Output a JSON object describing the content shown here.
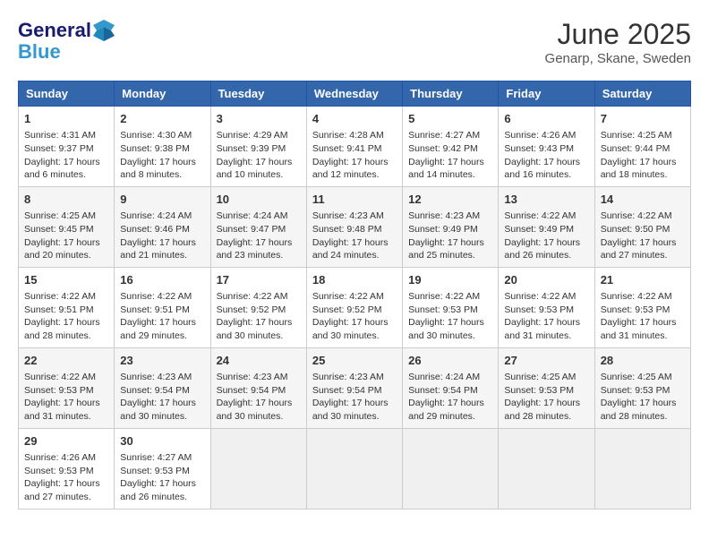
{
  "header": {
    "logo_line1": "General",
    "logo_line2": "Blue",
    "month": "June 2025",
    "location": "Genarp, Skane, Sweden"
  },
  "days_of_week": [
    "Sunday",
    "Monday",
    "Tuesday",
    "Wednesday",
    "Thursday",
    "Friday",
    "Saturday"
  ],
  "weeks": [
    [
      {
        "day": "1",
        "lines": [
          "Sunrise: 4:31 AM",
          "Sunset: 9:37 PM",
          "Daylight: 17 hours",
          "and 6 minutes."
        ]
      },
      {
        "day": "2",
        "lines": [
          "Sunrise: 4:30 AM",
          "Sunset: 9:38 PM",
          "Daylight: 17 hours",
          "and 8 minutes."
        ]
      },
      {
        "day": "3",
        "lines": [
          "Sunrise: 4:29 AM",
          "Sunset: 9:39 PM",
          "Daylight: 17 hours",
          "and 10 minutes."
        ]
      },
      {
        "day": "4",
        "lines": [
          "Sunrise: 4:28 AM",
          "Sunset: 9:41 PM",
          "Daylight: 17 hours",
          "and 12 minutes."
        ]
      },
      {
        "day": "5",
        "lines": [
          "Sunrise: 4:27 AM",
          "Sunset: 9:42 PM",
          "Daylight: 17 hours",
          "and 14 minutes."
        ]
      },
      {
        "day": "6",
        "lines": [
          "Sunrise: 4:26 AM",
          "Sunset: 9:43 PM",
          "Daylight: 17 hours",
          "and 16 minutes."
        ]
      },
      {
        "day": "7",
        "lines": [
          "Sunrise: 4:25 AM",
          "Sunset: 9:44 PM",
          "Daylight: 17 hours",
          "and 18 minutes."
        ]
      }
    ],
    [
      {
        "day": "8",
        "lines": [
          "Sunrise: 4:25 AM",
          "Sunset: 9:45 PM",
          "Daylight: 17 hours",
          "and 20 minutes."
        ]
      },
      {
        "day": "9",
        "lines": [
          "Sunrise: 4:24 AM",
          "Sunset: 9:46 PM",
          "Daylight: 17 hours",
          "and 21 minutes."
        ]
      },
      {
        "day": "10",
        "lines": [
          "Sunrise: 4:24 AM",
          "Sunset: 9:47 PM",
          "Daylight: 17 hours",
          "and 23 minutes."
        ]
      },
      {
        "day": "11",
        "lines": [
          "Sunrise: 4:23 AM",
          "Sunset: 9:48 PM",
          "Daylight: 17 hours",
          "and 24 minutes."
        ]
      },
      {
        "day": "12",
        "lines": [
          "Sunrise: 4:23 AM",
          "Sunset: 9:49 PM",
          "Daylight: 17 hours",
          "and 25 minutes."
        ]
      },
      {
        "day": "13",
        "lines": [
          "Sunrise: 4:22 AM",
          "Sunset: 9:49 PM",
          "Daylight: 17 hours",
          "and 26 minutes."
        ]
      },
      {
        "day": "14",
        "lines": [
          "Sunrise: 4:22 AM",
          "Sunset: 9:50 PM",
          "Daylight: 17 hours",
          "and 27 minutes."
        ]
      }
    ],
    [
      {
        "day": "15",
        "lines": [
          "Sunrise: 4:22 AM",
          "Sunset: 9:51 PM",
          "Daylight: 17 hours",
          "and 28 minutes."
        ]
      },
      {
        "day": "16",
        "lines": [
          "Sunrise: 4:22 AM",
          "Sunset: 9:51 PM",
          "Daylight: 17 hours",
          "and 29 minutes."
        ]
      },
      {
        "day": "17",
        "lines": [
          "Sunrise: 4:22 AM",
          "Sunset: 9:52 PM",
          "Daylight: 17 hours",
          "and 30 minutes."
        ]
      },
      {
        "day": "18",
        "lines": [
          "Sunrise: 4:22 AM",
          "Sunset: 9:52 PM",
          "Daylight: 17 hours",
          "and 30 minutes."
        ]
      },
      {
        "day": "19",
        "lines": [
          "Sunrise: 4:22 AM",
          "Sunset: 9:53 PM",
          "Daylight: 17 hours",
          "and 30 minutes."
        ]
      },
      {
        "day": "20",
        "lines": [
          "Sunrise: 4:22 AM",
          "Sunset: 9:53 PM",
          "Daylight: 17 hours",
          "and 31 minutes."
        ]
      },
      {
        "day": "21",
        "lines": [
          "Sunrise: 4:22 AM",
          "Sunset: 9:53 PM",
          "Daylight: 17 hours",
          "and 31 minutes."
        ]
      }
    ],
    [
      {
        "day": "22",
        "lines": [
          "Sunrise: 4:22 AM",
          "Sunset: 9:53 PM",
          "Daylight: 17 hours",
          "and 31 minutes."
        ]
      },
      {
        "day": "23",
        "lines": [
          "Sunrise: 4:23 AM",
          "Sunset: 9:54 PM",
          "Daylight: 17 hours",
          "and 30 minutes."
        ]
      },
      {
        "day": "24",
        "lines": [
          "Sunrise: 4:23 AM",
          "Sunset: 9:54 PM",
          "Daylight: 17 hours",
          "and 30 minutes."
        ]
      },
      {
        "day": "25",
        "lines": [
          "Sunrise: 4:23 AM",
          "Sunset: 9:54 PM",
          "Daylight: 17 hours",
          "and 30 minutes."
        ]
      },
      {
        "day": "26",
        "lines": [
          "Sunrise: 4:24 AM",
          "Sunset: 9:54 PM",
          "Daylight: 17 hours",
          "and 29 minutes."
        ]
      },
      {
        "day": "27",
        "lines": [
          "Sunrise: 4:25 AM",
          "Sunset: 9:53 PM",
          "Daylight: 17 hours",
          "and 28 minutes."
        ]
      },
      {
        "day": "28",
        "lines": [
          "Sunrise: 4:25 AM",
          "Sunset: 9:53 PM",
          "Daylight: 17 hours",
          "and 28 minutes."
        ]
      }
    ],
    [
      {
        "day": "29",
        "lines": [
          "Sunrise: 4:26 AM",
          "Sunset: 9:53 PM",
          "Daylight: 17 hours",
          "and 27 minutes."
        ]
      },
      {
        "day": "30",
        "lines": [
          "Sunrise: 4:27 AM",
          "Sunset: 9:53 PM",
          "Daylight: 17 hours",
          "and 26 minutes."
        ]
      },
      null,
      null,
      null,
      null,
      null
    ]
  ]
}
